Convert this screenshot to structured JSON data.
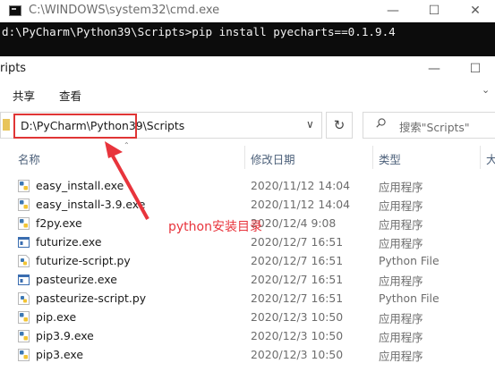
{
  "cmd": {
    "title": "C:\\WINDOWS\\system32\\cmd.exe",
    "min_glyph": "—",
    "max_glyph": "☐",
    "close_glyph": "✕",
    "console_line": "d:\\PyCharm\\Python39\\Scripts>pip install pyecharts==0.1.9.4"
  },
  "explorer": {
    "title": "ripts",
    "min_glyph": "—",
    "max_glyph": "☐",
    "ribbon": {
      "share": "共享",
      "view": "查看",
      "expand_glyph": "⌄"
    },
    "address": {
      "path": "D:\\PyCharm\\Python39\\Scripts",
      "dropdown_glyph": "∨"
    },
    "refresh_glyph": "↻",
    "search": {
      "placeholder": "搜索\"Scripts\""
    },
    "columns": {
      "name": "名称",
      "date": "修改日期",
      "type": "类型",
      "size": "大",
      "sort_glyph": "⌃"
    },
    "files": [
      {
        "name": "easy_install.exe",
        "date": "2020/11/12 14:04",
        "type": "应用程序",
        "icon": "python-exe-icon"
      },
      {
        "name": "easy_install-3.9.exe",
        "date": "2020/11/12 14:04",
        "type": "应用程序",
        "icon": "python-exe-icon"
      },
      {
        "name": "f2py.exe",
        "date": "2020/12/4 9:08",
        "type": "应用程序",
        "icon": "python-exe-icon"
      },
      {
        "name": "futurize.exe",
        "date": "2020/12/7 16:51",
        "type": "应用程序",
        "icon": "window-exe-icon"
      },
      {
        "name": "futurize-script.py",
        "date": "2020/12/7 16:51",
        "type": "Python File",
        "icon": "python-file-icon"
      },
      {
        "name": "pasteurize.exe",
        "date": "2020/12/7 16:51",
        "type": "应用程序",
        "icon": "window-exe-icon"
      },
      {
        "name": "pasteurize-script.py",
        "date": "2020/12/7 16:51",
        "type": "Python File",
        "icon": "python-file-icon"
      },
      {
        "name": "pip.exe",
        "date": "2020/12/3 10:50",
        "type": "应用程序",
        "icon": "python-exe-icon"
      },
      {
        "name": "pip3.9.exe",
        "date": "2020/12/3 10:50",
        "type": "应用程序",
        "icon": "python-exe-icon"
      },
      {
        "name": "pip3.exe",
        "date": "2020/12/3 10:50",
        "type": "应用程序",
        "icon": "python-exe-icon"
      }
    ]
  },
  "annotation": {
    "label": "python安装目录",
    "color": "#e8343c"
  },
  "colors": {
    "header_text": "#4c607a",
    "meta_text": "#6d6d6d",
    "console_bg": "#0c0c0c",
    "highlight": "#e03535"
  }
}
